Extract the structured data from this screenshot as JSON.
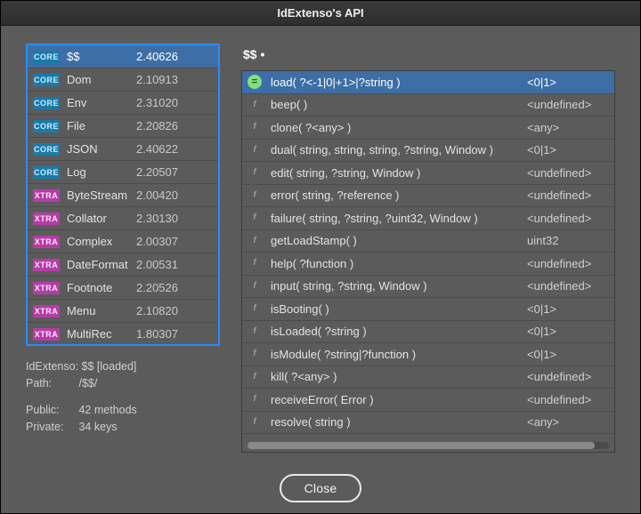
{
  "window": {
    "title": "IdExtenso's API"
  },
  "modules": [
    {
      "kind": "CORE",
      "name": "$$",
      "version": "2.40626",
      "selected": true
    },
    {
      "kind": "CORE",
      "name": "Dom",
      "version": "2.10913"
    },
    {
      "kind": "CORE",
      "name": "Env",
      "version": "2.31020"
    },
    {
      "kind": "CORE",
      "name": "File",
      "version": "2.20826"
    },
    {
      "kind": "CORE",
      "name": "JSON",
      "version": "2.40622"
    },
    {
      "kind": "CORE",
      "name": "Log",
      "version": "2.20507"
    },
    {
      "kind": "XTRA",
      "name": "ByteStream",
      "version": "2.00420"
    },
    {
      "kind": "XTRA",
      "name": "Collator",
      "version": "2.30130"
    },
    {
      "kind": "XTRA",
      "name": "Complex",
      "version": "2.00307"
    },
    {
      "kind": "XTRA",
      "name": "DateFormat",
      "version": "2.00531"
    },
    {
      "kind": "XTRA",
      "name": "Footnote",
      "version": "2.20526"
    },
    {
      "kind": "XTRA",
      "name": "Menu",
      "version": "2.10820"
    },
    {
      "kind": "XTRA",
      "name": "MultiRec",
      "version": "1.80307"
    }
  ],
  "info": {
    "line1": "IdExtenso: $$  [loaded]",
    "path_label": "Path:",
    "path_value": "/$$/",
    "public_label": "Public:",
    "public_value": "42 methods",
    "private_label": "Private:",
    "private_value": "34 keys"
  },
  "breadcrumb": "$$ •",
  "methods": [
    {
      "sig": "load( ?<-1|0|+1>|?string )",
      "ret": "<0|1>",
      "selected": true
    },
    {
      "sig": "beep( )",
      "ret": "<undefined>"
    },
    {
      "sig": "clone( ?<any> )",
      "ret": "<any>"
    },
    {
      "sig": "dual( string, string, string, ?string, Window )",
      "ret": "<0|1>"
    },
    {
      "sig": "edit( string, ?string, Window )",
      "ret": "<undefined>"
    },
    {
      "sig": "error( string, ?reference )",
      "ret": "<undefined>"
    },
    {
      "sig": "failure( string, ?string, ?uint32, Window )",
      "ret": "<undefined>"
    },
    {
      "sig": "getLoadStamp( )",
      "ret": "uint32"
    },
    {
      "sig": "help( ?function )",
      "ret": "<undefined>"
    },
    {
      "sig": "input( string, ?string, Window )",
      "ret": "<undefined>"
    },
    {
      "sig": "isBooting( )",
      "ret": "<0|1>"
    },
    {
      "sig": "isLoaded( ?string )",
      "ret": "<0|1>"
    },
    {
      "sig": "isModule( ?string|?function )",
      "ret": "<0|1>"
    },
    {
      "sig": "kill( ?<any> )",
      "ret": "<undefined>"
    },
    {
      "sig": "receiveError( Error )",
      "ret": "<undefined>"
    },
    {
      "sig": "resolve( string )",
      "ret": "<any>"
    }
  ],
  "buttons": {
    "close": "Close"
  },
  "icons": {
    "module_core": "CORE",
    "module_xtra": "XTRA",
    "method_f": "f",
    "method_sel": "="
  }
}
